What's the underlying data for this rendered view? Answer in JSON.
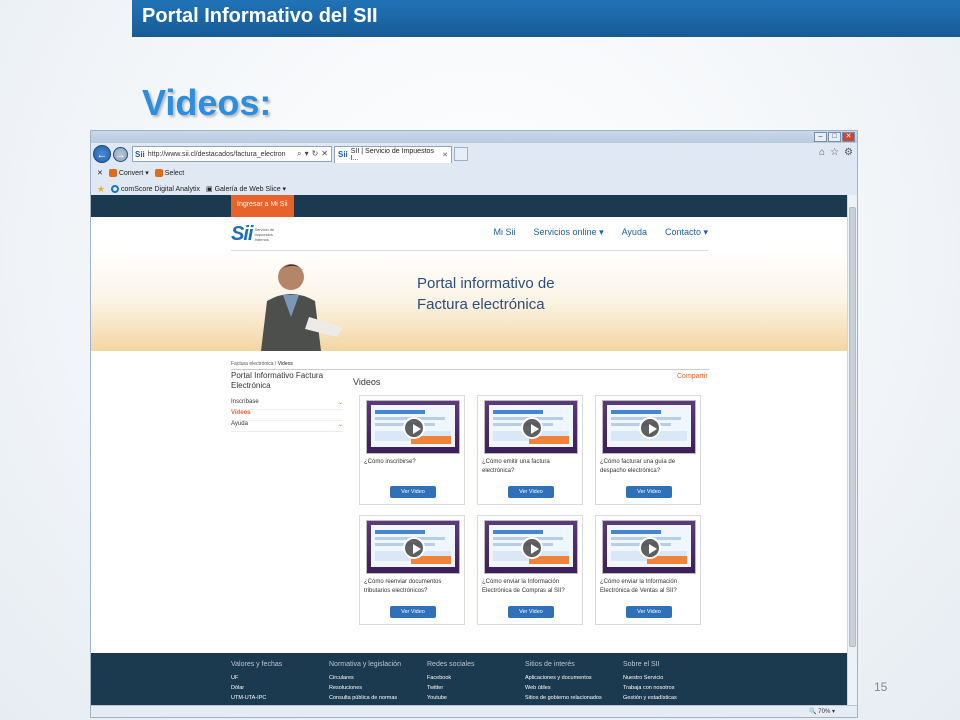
{
  "slide": {
    "banner": "Portal Informativo del SII",
    "title": "Videos:",
    "page_number": "15"
  },
  "browser": {
    "url": "http://www.sii.cl/destacados/factura_electron",
    "tab_title": "SII | Servicio de Impuestos I...",
    "command_bar": {
      "convert": "Convert",
      "select": "Select"
    },
    "favorites": {
      "comscore": "comScore Digital Analytix",
      "gallery": "Galería de Web Slice"
    },
    "zoom": "70%"
  },
  "site": {
    "login_button": "Ingresar a Mi Sii",
    "logo_text": "Sii",
    "logo_sub": "Servicio de Impuestos Internos",
    "menu": [
      "Mi Sii",
      "Servicios online ▾",
      "Ayuda",
      "Contacto ▾"
    ],
    "hero_title_line1": "Portal informativo de",
    "hero_title_line2": "Factura electrónica",
    "breadcrumb": {
      "parent": "Factura electrónica",
      "sep": "/",
      "current": "Videos"
    },
    "sidebar_title": "Portal Informativo Factura Electrónica",
    "sidebar_items": [
      {
        "label": "Inscríbase",
        "active": false
      },
      {
        "label": "Videos",
        "active": true
      },
      {
        "label": "Ayuda",
        "active": false
      }
    ],
    "section_title": "Videos",
    "share": "Compartir",
    "videos": [
      {
        "caption": "¿Cómo inscribirse?",
        "button": "Ver Video"
      },
      {
        "caption": "¿Cómo emitir una factura electrónica?",
        "button": "Ver Video"
      },
      {
        "caption": "¿Cómo facturar una guía de despacho electrónica?",
        "button": "Ver Video"
      },
      {
        "caption": "¿Cómo reenviar documentos tributarios electrónicos?",
        "button": "Ver Video"
      },
      {
        "caption": "¿Cómo enviar la Información Electrónica de Compras al SII?",
        "button": "Ver Video"
      },
      {
        "caption": "¿Cómo enviar la Información Electrónica de Ventas al SII?",
        "button": "Ver Video"
      }
    ],
    "footer": [
      {
        "heading": "Valores y fechas",
        "items": [
          "UF",
          "Dólar",
          "UTM-UTA-IPC"
        ]
      },
      {
        "heading": "Normativa y legislación",
        "items": [
          "Circulares",
          "Resoluciones",
          "Consulta pública de normas"
        ]
      },
      {
        "heading": "Redes sociales",
        "items": [
          "Facebook",
          "Twitter",
          "Youtube"
        ]
      },
      {
        "heading": "Sitios de interés",
        "items": [
          "Aplicaciones y documentos",
          "Web útiles",
          "Sitios de gobierno relacionados"
        ]
      },
      {
        "heading": "Sobre el SII",
        "items": [
          "Nuestro Servicio",
          "Trabaja con nosotros",
          "Gestión y estadísticas"
        ]
      }
    ]
  }
}
